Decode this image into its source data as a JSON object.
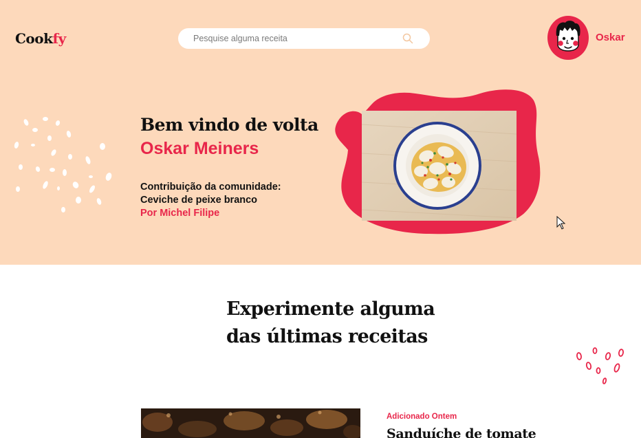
{
  "header": {
    "logo_part1": "Cook",
    "logo_part2": "fy",
    "search_placeholder": "Pesquise alguma receita",
    "search_icon": "search-icon",
    "user_name": "Oskar",
    "avatar_icon": "cartoon-face-avatar"
  },
  "hero": {
    "greeting": "Bem vindo de volta",
    "user_full_name": "Oskar Meiners",
    "contribution_label": "Contribuição da comunidade:",
    "recipe_name": "Ceviche de peixe branco",
    "author": "Por Michel Filipe"
  },
  "latest": {
    "title_line1": "Experimente alguma",
    "title_line2": "das últimas receitas",
    "recipe": {
      "added": "Adicionado Ontem",
      "title": "Sanduíche de tomate"
    }
  },
  "colors": {
    "accent": "#e8264a",
    "hero_background": "#fdd9bb",
    "text": "#111111"
  }
}
